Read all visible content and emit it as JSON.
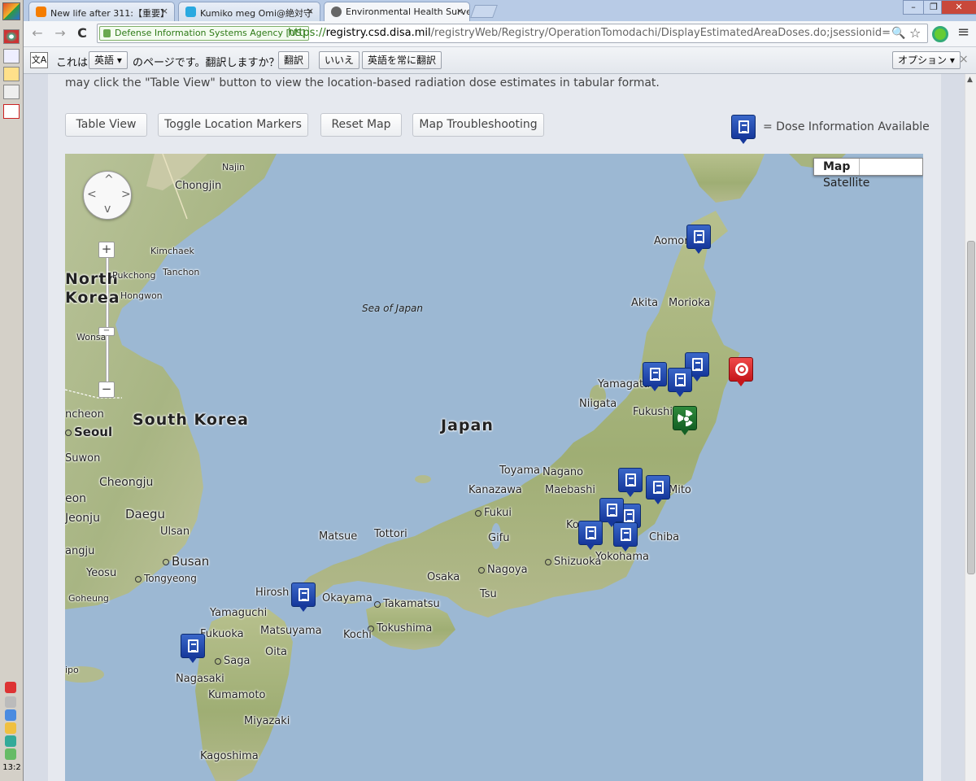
{
  "tabs": [
    {
      "title": "New life after 311:【重要】",
      "close": "×"
    },
    {
      "title": "Kumiko meg Omi@絶対守",
      "close": "×"
    },
    {
      "title": "Environmental Health Surve",
      "close": "×"
    }
  ],
  "window_controls": {
    "minimize": "–",
    "restore": "❐",
    "close": "✕"
  },
  "toolbar": {
    "back": "←",
    "forward": "→",
    "reload": "C",
    "ev_label": "Defense Information Systems Agency [US]",
    "url_scheme": "https://",
    "url_host": "registry.csd.disa.mil",
    "url_path": "/registryWeb/Registry/OperationTomodachi/DisplayEstimatedAreaDoses.do;jsessionid=a13932a1a",
    "search_icon": "🔍",
    "star_icon": "☆",
    "menu_icon": "≡"
  },
  "translate_bar": {
    "icon": "文A",
    "prefix": "これは",
    "language": "英語 ▾",
    "question": "のページです。翻訳しますか？",
    "translate": "翻訳",
    "no": "いいえ",
    "always": "英語を常に翻訳",
    "options": "オプション ▾",
    "close": "×"
  },
  "page": {
    "intro": "may click the \"Table View\" button to view the location-based radiation dose estimates in tabular format.",
    "buttons": {
      "table_view": "Table View",
      "toggle_markers": "Toggle Location Markers",
      "reset_map": "Reset Map",
      "troubleshooting": "Map Troubleshooting"
    },
    "legend_text": "= Dose Information Available"
  },
  "map": {
    "type_map": "Map",
    "type_satellite": "Satellite",
    "pan": {
      "up": "^",
      "down": "v",
      "left": "<",
      "right": ">"
    },
    "zoom_in": "+",
    "zoom_out": "−",
    "zoom_level_mark": "−",
    "labels": {
      "najin": "Najin",
      "chongjin": "Chongjin",
      "kimchaek": "Kimchaek",
      "north": "North",
      "korea": "Korea",
      "pukchong": "Pukchong",
      "tanchon": "Tanchon",
      "hongwon": "Hongwon",
      "wonsan": "Wonsa",
      "sea_of_japan": "Sea of Japan",
      "south_korea": "South Korea",
      "japan": "Japan",
      "incheon": "ncheon",
      "seoul": "Seoul",
      "suwon": "Suwon",
      "cheongju": "Cheongju",
      "yeon": "eon",
      "jeonju": "Jeonju",
      "daegu": "Daegu",
      "ulsan": "Ulsan",
      "gangju": "angju",
      "busan": "Busan",
      "yeosu": "Yeosu",
      "tongyeong": "Tongyeong",
      "goheung": "Goheung",
      "jeju": "ipo",
      "aomori": "Aomori",
      "akita": "Akita",
      "morioka": "Morioka",
      "yamagata": "Yamagata",
      "niigata": "Niigata",
      "fukushima": "Fukushi",
      "toyama": "Toyama",
      "nagano": "Nagano",
      "kanazawa": "Kanazawa",
      "maebashi": "Maebashi",
      "mito": "Mito",
      "fukui": "Fukui",
      "gifu": "Gifu",
      "chiba": "Chiba",
      "yokohama": "Yokohama",
      "shizuoka": "Shizuoka",
      "matsue": "Matsue",
      "tottori": "Tottori",
      "osaka": "Osaka",
      "nagoya": "Nagoya",
      "kobe": "Ko",
      "tsu": "Tsu",
      "hiroshima": "Hirosh",
      "okayama": "Okayama",
      "takamatsu": "Takamatsu",
      "yamaguchi": "Yamaguchi",
      "matsuyama": "Matsuyama",
      "tokushima": "Tokushima",
      "kochi": "Kochi",
      "fukuoka": "Fukuoka",
      "oita": "Oita",
      "saga": "Saga",
      "nagasaki": "Nagasaki",
      "kumamoto": "Kumamoto",
      "miyazaki": "Miyazaki",
      "kagoshima": "Kagoshima"
    }
  },
  "taskbar": {
    "clock": "13:2"
  },
  "colors": {
    "dose_marker": "#1f46a8",
    "target_marker": "#d11d22",
    "reactor_marker": "#1d6e2c",
    "sea": "#9cb8d3"
  }
}
